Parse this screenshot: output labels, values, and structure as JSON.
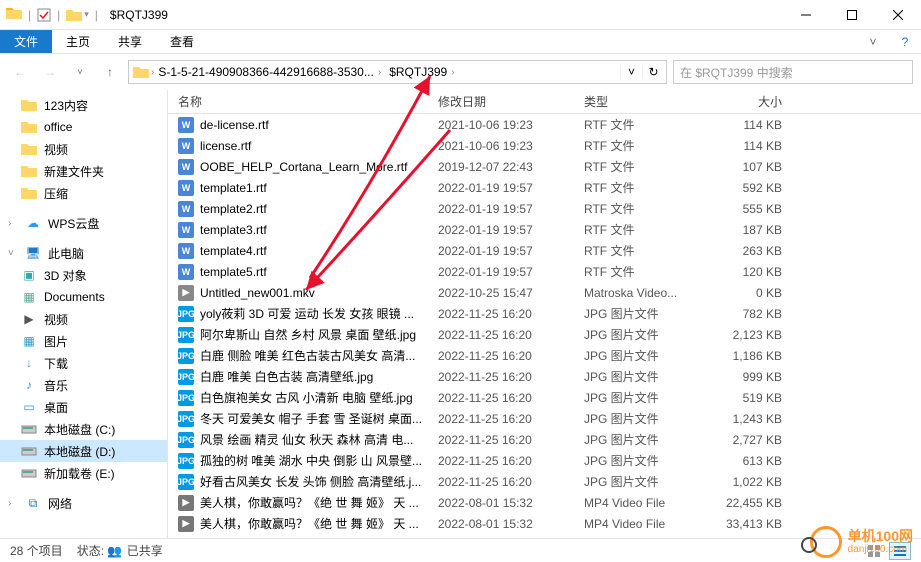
{
  "window": {
    "title": "$RQTJ399"
  },
  "ribbon": {
    "file": "文件",
    "home": "主页",
    "share": "共享",
    "view": "查看"
  },
  "address": {
    "seg1": "S-1-5-21-490908366-442916688-3530...",
    "seg2": "$RQTJ399"
  },
  "search": {
    "placeholder": "在 $RQTJ399 中搜索"
  },
  "columns": {
    "name": "名称",
    "date": "修改日期",
    "type": "类型",
    "size": "大小"
  },
  "sidebar": {
    "items": [
      {
        "label": "123内容",
        "kind": "folder"
      },
      {
        "label": "office",
        "kind": "folder"
      },
      {
        "label": "视频",
        "kind": "folder-blk"
      },
      {
        "label": "新建文件夹",
        "kind": "folder"
      },
      {
        "label": "压缩",
        "kind": "folder"
      }
    ],
    "wps": "WPS云盘",
    "thispc": "此电脑",
    "pc_items": [
      {
        "label": "3D 对象",
        "kind": "3d"
      },
      {
        "label": "Documents",
        "kind": "docs"
      },
      {
        "label": "视频",
        "kind": "video"
      },
      {
        "label": "图片",
        "kind": "pics"
      },
      {
        "label": "下载",
        "kind": "dl"
      },
      {
        "label": "音乐",
        "kind": "music"
      },
      {
        "label": "桌面",
        "kind": "desk"
      },
      {
        "label": "本地磁盘 (C:)",
        "kind": "drive"
      },
      {
        "label": "本地磁盘 (D:)",
        "kind": "drive",
        "selected": true
      },
      {
        "label": "新加载卷 (E:)",
        "kind": "drive"
      }
    ],
    "network": "网络"
  },
  "files": [
    {
      "icon": "rtf",
      "name": "de-license.rtf",
      "date": "2021-10-06 19:23",
      "type": "RTF 文件",
      "size": "114 KB"
    },
    {
      "icon": "rtf",
      "name": "license.rtf",
      "date": "2021-10-06 19:23",
      "type": "RTF 文件",
      "size": "114 KB"
    },
    {
      "icon": "rtf",
      "name": "OOBE_HELP_Cortana_Learn_More.rtf",
      "date": "2019-12-07 22:43",
      "type": "RTF 文件",
      "size": "107 KB"
    },
    {
      "icon": "rtf",
      "name": "template1.rtf",
      "date": "2022-01-19 19:57",
      "type": "RTF 文件",
      "size": "592 KB"
    },
    {
      "icon": "rtf",
      "name": "template2.rtf",
      "date": "2022-01-19 19:57",
      "type": "RTF 文件",
      "size": "555 KB"
    },
    {
      "icon": "rtf",
      "name": "template3.rtf",
      "date": "2022-01-19 19:57",
      "type": "RTF 文件",
      "size": "187 KB"
    },
    {
      "icon": "rtf",
      "name": "template4.rtf",
      "date": "2022-01-19 19:57",
      "type": "RTF 文件",
      "size": "263 KB"
    },
    {
      "icon": "rtf",
      "name": "template5.rtf",
      "date": "2022-01-19 19:57",
      "type": "RTF 文件",
      "size": "120 KB"
    },
    {
      "icon": "mkv",
      "name": "Untitled_new001.mkv",
      "date": "2022-10-25 15:47",
      "type": "Matroska Video...",
      "size": "0 KB"
    },
    {
      "icon": "jpg",
      "name": "yoly莜莉 3D 可爱 运动 长发 女孩 眼镜 ...",
      "date": "2022-11-25 16:20",
      "type": "JPG 图片文件",
      "size": "782 KB"
    },
    {
      "icon": "jpg",
      "name": "阿尔卑斯山 自然 乡村 风景 桌面 壁纸.jpg",
      "date": "2022-11-25 16:20",
      "type": "JPG 图片文件",
      "size": "2,123 KB"
    },
    {
      "icon": "jpg",
      "name": "白鹿 侧脸 唯美 红色古装古风美女 高清...",
      "date": "2022-11-25 16:20",
      "type": "JPG 图片文件",
      "size": "1,186 KB"
    },
    {
      "icon": "jpg",
      "name": "白鹿 唯美 白色古装 高清壁纸.jpg",
      "date": "2022-11-25 16:20",
      "type": "JPG 图片文件",
      "size": "999 KB"
    },
    {
      "icon": "jpg",
      "name": "白色旗袍美女 古风 小清新 电脑 壁纸.jpg",
      "date": "2022-11-25 16:20",
      "type": "JPG 图片文件",
      "size": "519 KB"
    },
    {
      "icon": "jpg",
      "name": "冬天 可爱美女 帽子 手套 雪 圣诞树 桌面...",
      "date": "2022-11-25 16:20",
      "type": "JPG 图片文件",
      "size": "1,243 KB"
    },
    {
      "icon": "jpg",
      "name": "风景 绘画 精灵 仙女 秋天 森林 高清 电...",
      "date": "2022-11-25 16:20",
      "type": "JPG 图片文件",
      "size": "2,727 KB"
    },
    {
      "icon": "jpg",
      "name": "孤独的树 唯美 湖水 中央 倒影 山 风景壁...",
      "date": "2022-11-25 16:20",
      "type": "JPG 图片文件",
      "size": "613 KB"
    },
    {
      "icon": "jpg",
      "name": "好看古风美女 长发 头饰 侧脸 高清壁纸.j...",
      "date": "2022-11-25 16:20",
      "type": "JPG 图片文件",
      "size": "1,022 KB"
    },
    {
      "icon": "mp4",
      "name": "美人棋，你敢赢吗？《绝 世 舞 姬》 天 ...",
      "date": "2022-08-01 15:32",
      "type": "MP4 Video File",
      "size": "22,455 KB"
    },
    {
      "icon": "mp4",
      "name": "美人棋，你敢赢吗？《绝 世 舞 姬》 天 ...",
      "date": "2022-08-01 15:32",
      "type": "MP4 Video File",
      "size": "33,413 KB"
    }
  ],
  "status": {
    "count": "28 个项目",
    "state_label": "状态:",
    "state": "已共享"
  },
  "watermark": {
    "cn": "单机100网",
    "en": "danji100.com"
  }
}
